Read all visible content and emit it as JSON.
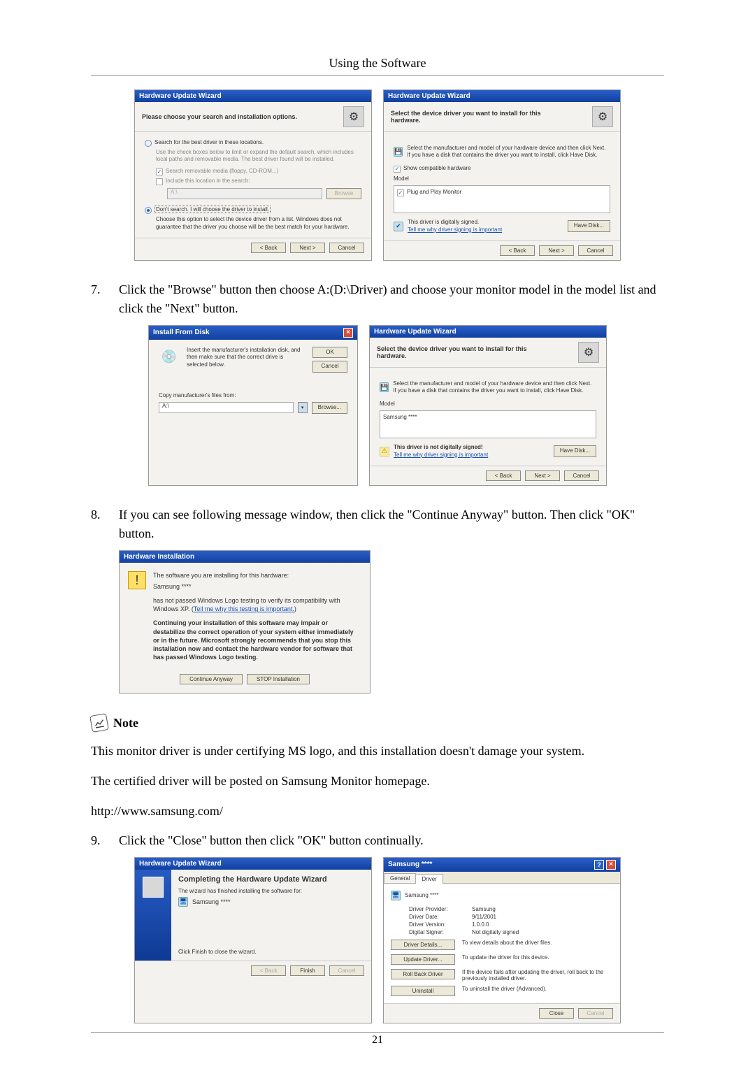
{
  "header": {
    "title": "Using the Software"
  },
  "page_number": "21",
  "step7": {
    "num": "7.",
    "text": "Click the \"Browse\" button then choose A:(D:\\Driver) and choose your monitor model in the model list and click the \"Next\" button."
  },
  "step8": {
    "num": "8.",
    "text": "If you can see following message window, then click the \"Continue Anyway\" button. Then click \"OK\" button."
  },
  "step9": {
    "num": "9.",
    "text": "Click the \"Close\" button then click \"OK\" button continually."
  },
  "note": {
    "label": "Note",
    "line1": "This monitor driver is under certifying MS logo, and this installation doesn't damage your system.",
    "line2": "The certified driver will be posted on Samsung Monitor homepage.",
    "line3": "http://www.samsung.com/"
  },
  "wiz_title": "Hardware Update Wizard",
  "dlg1": {
    "header": "Please choose your search and installation options.",
    "opt1": "Search for the best driver in these locations.",
    "opt1_sub": "Use the check boxes below to limit or expand the default search, which includes local paths and removable media. The best driver found will be installed.",
    "chk1": "Search removable media (floppy, CD-ROM...)",
    "chk2": "Include this location in the search:",
    "path": "A:\\",
    "browse": "Browse",
    "opt2": "Don't search. I will choose the driver to install.",
    "opt2_sub": "Choose this option to select the device driver from a list. Windows does not guarantee that the driver you choose will be the best match for your hardware.",
    "back": "< Back",
    "next": "Next >",
    "cancel": "Cancel"
  },
  "dlg2": {
    "header": "Select the device driver you want to install for this hardware.",
    "lead": "Select the manufacturer and model of your hardware device and then click Next. If you have a disk that contains the driver you want to install, click Have Disk.",
    "show_compat": "Show compatible hardware",
    "model_lbl": "Model",
    "model_val": "Plug and Play Monitor",
    "signed": "This driver is digitally signed.",
    "tell": "Tell me why driver signing is important",
    "have_disk": "Have Disk...",
    "back": "< Back",
    "next": "Next >",
    "cancel": "Cancel"
  },
  "install_disk": {
    "title": "Install From Disk",
    "lead": "Insert the manufacturer's installation disk, and then make sure that the correct drive is selected below.",
    "ok": "OK",
    "cancel": "Cancel",
    "copy_lbl": "Copy manufacturer's files from:",
    "path": "A:\\",
    "browse": "Browse..."
  },
  "dlg3": {
    "header": "Select the device driver you want to install for this hardware.",
    "lead": "Select the manufacturer and model of your hardware device and then click Next. If you have a disk that contains the driver you want to install, click Have Disk.",
    "model_lbl": "Model",
    "model_val": "Samsung ****",
    "not_signed": "This driver is not digitally signed!",
    "tell": "Tell me why driver signing is important",
    "have_disk": "Have Disk...",
    "back": "< Back",
    "next": "Next >",
    "cancel": "Cancel"
  },
  "hw_install": {
    "title": "Hardware Installation",
    "line1": "The software you are installing for this hardware:",
    "line2": "Samsung ****",
    "line3": "has not passed Windows Logo testing to verify its compatibility with Windows XP. (",
    "tell": "Tell me why this testing is important.",
    "bold": "Continuing your installation of this software may impair or destabilize the correct operation of your system either immediately or in the future. Microsoft strongly recommends that you stop this installation now and contact the hardware vendor for software that has passed Windows Logo testing.",
    "cont": "Continue Anyway",
    "stop": "STOP Installation"
  },
  "completing": {
    "title": "Completing the Hardware Update Wizard",
    "lead": "The wizard has finished installing the software for:",
    "device": "Samsung ****",
    "finish_lead": "Click Finish to close the wizard.",
    "back": "< Back",
    "finish": "Finish",
    "cancel": "Cancel"
  },
  "props": {
    "wintitle": "Samsung ****",
    "tab_general": "General",
    "tab_driver": "Driver",
    "device": "Samsung ****",
    "kv": {
      "provider_k": "Driver Provider:",
      "provider_v": "Samsung",
      "date_k": "Driver Date:",
      "date_v": "9/11/2001",
      "version_k": "Driver Version:",
      "version_v": "1.0.0.0",
      "signer_k": "Digital Signer:",
      "signer_v": "Not digitally signed"
    },
    "btn_details": "Driver Details...",
    "desc_details": "To view details about the driver files.",
    "btn_update": "Update Driver...",
    "desc_update": "To update the driver for this device.",
    "btn_rollback": "Roll Back Driver",
    "desc_rollback": "If the device fails after updating the driver, roll back to the previously installed driver.",
    "btn_uninstall": "Uninstall",
    "desc_uninstall": "To uninstall the driver (Advanced).",
    "close": "Close",
    "cancel": "Cancel"
  }
}
